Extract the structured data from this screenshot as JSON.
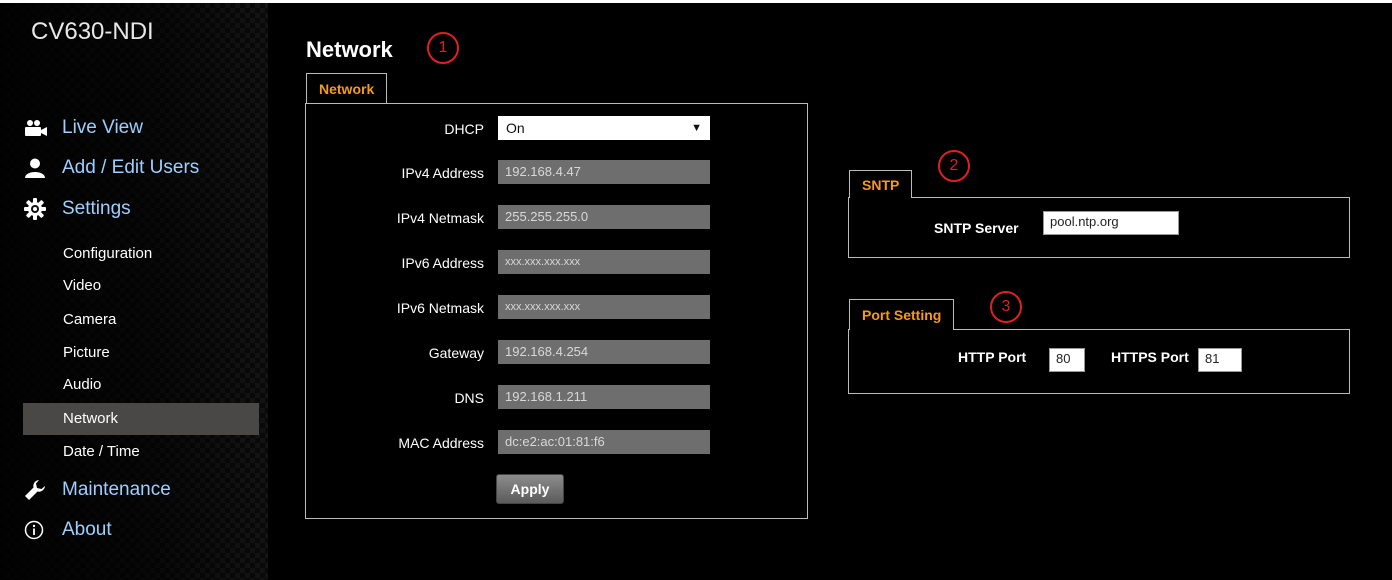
{
  "app": {
    "title": "CV630-NDI"
  },
  "nav": {
    "main": [
      {
        "id": "live-view",
        "label": "Live View",
        "icon": "camera-icon"
      },
      {
        "id": "add-edit-users",
        "label": "Add / Edit Users",
        "icon": "user-icon"
      },
      {
        "id": "settings",
        "label": "Settings",
        "icon": "gear-icon"
      },
      {
        "id": "maintenance",
        "label": "Maintenance",
        "icon": "wrench-icon"
      },
      {
        "id": "about",
        "label": "About",
        "icon": "info-icon"
      }
    ],
    "sub": [
      {
        "label": "Configuration"
      },
      {
        "label": "Video"
      },
      {
        "label": "Camera"
      },
      {
        "label": "Picture"
      },
      {
        "label": "Audio"
      },
      {
        "label": "Network",
        "active": true
      },
      {
        "label": "Date / Time"
      }
    ]
  },
  "page": {
    "title": "Network"
  },
  "markers": [
    "1",
    "2",
    "3"
  ],
  "network": {
    "tab": "Network",
    "dhcp": {
      "label": "DHCP",
      "value": "On"
    },
    "fields": [
      {
        "label": "IPv4 Address",
        "value": "192.168.4.47"
      },
      {
        "label": "IPv4 Netmask",
        "value": "255.255.255.0"
      },
      {
        "label": "IPv6 Address",
        "value": "xxx.xxx.xxx.xxx"
      },
      {
        "label": "IPv6 Netmask",
        "value": "xxx.xxx.xxx.xxx"
      },
      {
        "label": "Gateway",
        "value": "192.168.4.254"
      },
      {
        "label": "DNS",
        "value": "192.168.1.211"
      },
      {
        "label": "MAC Address",
        "value": "dc:e2:ac:01:81:f6"
      }
    ],
    "apply_label": "Apply"
  },
  "sntp": {
    "tab": "SNTP",
    "server_label": "SNTP Server",
    "server_value": "pool.ntp.org"
  },
  "port": {
    "tab": "Port Setting",
    "http_label": "HTTP Port",
    "http_value": "80",
    "https_label": "HTTPS Port",
    "https_value": "81"
  },
  "colors": {
    "accent": "#f59a1c",
    "nav_link": "#9ecfff",
    "marker": "#e02020",
    "active_bg": "#4a4747"
  }
}
